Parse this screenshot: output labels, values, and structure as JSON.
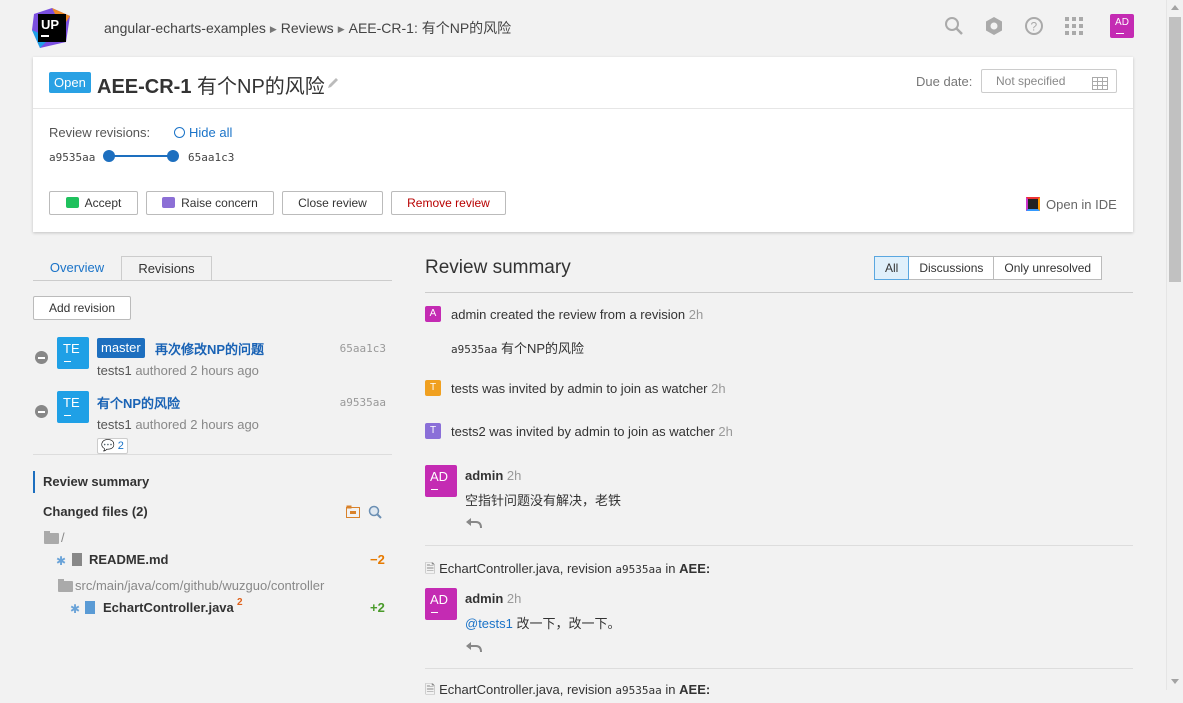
{
  "breadcrumb": {
    "project": "angular-echarts-examples",
    "section": "Reviews",
    "current": "AEE-CR-1: 有个NP的风险"
  },
  "header": {
    "avatar": "AD",
    "icons": [
      "search-icon",
      "hexagon-icon",
      "help-icon",
      "apps-grid-icon"
    ]
  },
  "review": {
    "status": "Open",
    "id": "AEE-CR-1",
    "title": "有个NP的风险",
    "due_label": "Due date:",
    "due_value": "Not specified",
    "revisions_label": "Review revisions:",
    "hide_all": "Hide all",
    "rev_from": "a9535aa",
    "rev_to": "65aa1c3",
    "buttons": {
      "accept": "Accept",
      "concern": "Raise concern",
      "close": "Close review",
      "remove": "Remove review"
    },
    "open_ide": "Open in IDE"
  },
  "left": {
    "tabs": {
      "overview": "Overview",
      "revisions": "Revisions"
    },
    "add_revision": "Add revision",
    "revisions": [
      {
        "avatar": "TE",
        "branch": "master",
        "message": "再次修改NP的问题",
        "hash": "65aa1c3",
        "author": "tests1",
        "authored": "authored 2 hours ago"
      },
      {
        "avatar": "TE",
        "message": "有个NP的风险",
        "hash": "a9535aa",
        "author": "tests1",
        "authored": "authored 2 hours ago",
        "comments": "2"
      }
    ],
    "review_summary": "Review summary",
    "changed_files": "Changed files (2)",
    "root": "/",
    "file1": {
      "name": "README.md",
      "diff": "−2"
    },
    "folder2": "src/main/java/com/github/wuzguo/controller",
    "file2": {
      "name": "EchartController.java",
      "badge": "2",
      "diff": "+2"
    }
  },
  "right": {
    "title": "Review summary",
    "filters": [
      "All",
      "Discussions",
      "Only unresolved"
    ],
    "activity": [
      {
        "avatar": "A",
        "text": "admin created the review from a revision",
        "time": "2h",
        "color": "#c42bb3"
      },
      {
        "hash": "a9535aa",
        "msg": "有个NP的风险"
      },
      {
        "avatar": "T",
        "text": "tests was invited by admin to join as watcher",
        "time": "2h",
        "color": "#f0a020"
      },
      {
        "avatar": "T",
        "text": "tests2 was invited by admin to join as watcher",
        "time": "2h",
        "color": "#8a6fd8"
      }
    ],
    "comment1": {
      "avatar": "AD",
      "author": "admin",
      "time": "2h",
      "text": "空指针问题没有解决，老铁"
    },
    "file_ref1": {
      "file": "EchartController.java, revision",
      "hash": "a9535aa",
      "in": "in",
      "project": "AEE:"
    },
    "comment2": {
      "avatar": "AD",
      "author": "admin",
      "time": "2h",
      "mention": "@tests1",
      "text": "改一下，改一下。"
    },
    "file_ref2": {
      "file": "EchartController.java, revision",
      "hash": "a9535aa",
      "in": "in",
      "project": "AEE:"
    }
  }
}
